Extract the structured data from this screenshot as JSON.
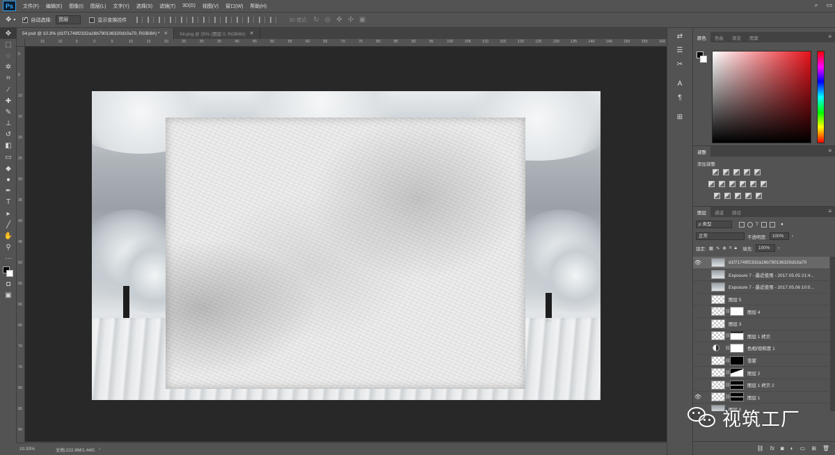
{
  "app": {
    "logo": "Ps"
  },
  "menu": [
    "文件(F)",
    "编辑(E)",
    "图像(I)",
    "图层(L)",
    "文字(Y)",
    "选择(S)",
    "滤镜(T)",
    "3D(D)",
    "视图(V)",
    "窗口(W)",
    "帮助(H)"
  ],
  "options": {
    "auto_select_label": "自动选择:",
    "auto_select_value": "图层",
    "show_transform_label": "显示变换控件",
    "mode_3d_label": "3D 模式:"
  },
  "tabs": [
    {
      "label": "54.psd @ 10.3% (d1f71749f2332a16b790136320d10a70, RGB/8#) *",
      "active": true
    },
    {
      "label": "54.png @ 25% (图层 0, RGB/8#)",
      "active": false
    }
  ],
  "rulers": {
    "top": [
      "15",
      "10",
      "5",
      "0",
      "5",
      "10",
      "15",
      "20",
      "25",
      "30",
      "35",
      "40",
      "45",
      "50",
      "55",
      "60",
      "65",
      "70",
      "75",
      "80",
      "85",
      "90",
      "95",
      "100",
      "105",
      "110",
      "115",
      "120",
      "125",
      "130",
      "135",
      "140",
      "145",
      "150",
      "155",
      "160"
    ],
    "left": [
      "0",
      "5",
      "10",
      "15",
      "20",
      "25",
      "30",
      "35",
      "40",
      "45",
      "50",
      "55",
      "60",
      "65",
      "70",
      "75",
      "80",
      "85",
      "90"
    ]
  },
  "status": {
    "zoom": "10.33%",
    "doc": "文档:222.8M/1.44G"
  },
  "color_panel": {
    "tabs": [
      "颜色",
      "色板",
      "渐变",
      "图案"
    ],
    "hue_color": "#e8121a"
  },
  "adjust_panel": {
    "tab": "调整",
    "title": "添加调整"
  },
  "layers_panel": {
    "tabs": [
      "图层",
      "通道",
      "路径"
    ],
    "filter_kind": "ρ 类型",
    "blend_mode": "正常",
    "opacity_label": "不透明度:",
    "opacity_value": "100%",
    "lock_label": "锁定:",
    "fill_label": "填充:",
    "fill_value": "100%",
    "layers": [
      {
        "name": "d1f71749f2332a16b790136320d10a70",
        "visible": true,
        "selected": true,
        "thumb": "img",
        "mask": ""
      },
      {
        "name": "Exposure 7 - 最近使用 - 2017.05.05 21:4...",
        "visible": false,
        "selected": false,
        "thumb": "img",
        "mask": ""
      },
      {
        "name": "Exposure 7 - 最近使用 - 2017.05.06 10:0...",
        "visible": false,
        "selected": false,
        "thumb": "img",
        "mask": ""
      },
      {
        "name": "图层 5",
        "visible": false,
        "selected": false,
        "thumb": "checker",
        "mask": ""
      },
      {
        "name": "图层 4",
        "visible": false,
        "selected": false,
        "thumb": "checker",
        "mask": "white"
      },
      {
        "name": "图层 3",
        "visible": false,
        "selected": false,
        "thumb": "checker",
        "mask": ""
      },
      {
        "name": "图层 1 拷贝",
        "visible": false,
        "selected": false,
        "thumb": "checker",
        "mask": "curve"
      },
      {
        "name": "色相/饱和度 1",
        "visible": false,
        "selected": false,
        "thumb": "adjust",
        "mask": "white"
      },
      {
        "name": "雪雾",
        "visible": false,
        "selected": false,
        "thumb": "checker",
        "mask": "black"
      },
      {
        "name": "图层 2",
        "visible": false,
        "selected": false,
        "thumb": "checker",
        "mask": "mixed"
      },
      {
        "name": "图层 1 拷贝 2",
        "visible": false,
        "selected": false,
        "thumb": "checker",
        "mask": "line"
      },
      {
        "name": "图层 1",
        "visible": true,
        "selected": false,
        "thumb": "checker",
        "mask": "line"
      },
      {
        "name": "图层 0",
        "visible": false,
        "selected": false,
        "thumb": "img",
        "mask": ""
      }
    ]
  },
  "watermark": {
    "text": "视筑工厂"
  }
}
